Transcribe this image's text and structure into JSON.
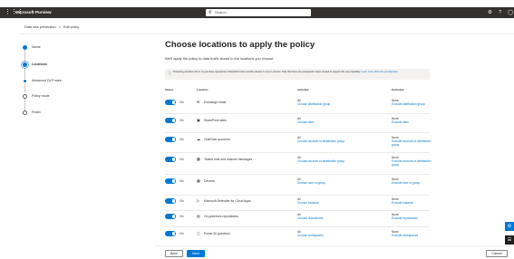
{
  "topbar": {
    "app_name": "Microsoft Purview",
    "search_placeholder": "Search",
    "waffle_glyph": "⋮⋮⋮",
    "settings_glyph": "⚙",
    "help_glyph": "?",
    "account_glyph": "◯"
  },
  "breadcrumb": {
    "items": [
      "Data loss prevention",
      ">",
      "Edit policy"
    ]
  },
  "steps": [
    {
      "label": "Name",
      "state": "done"
    },
    {
      "label": "Locations",
      "state": "current"
    },
    {
      "label": "Advanced DLP rules",
      "state": "upcoming"
    },
    {
      "label": "Policy mode",
      "state": "upcoming"
    },
    {
      "label": "Finish",
      "state": "upcoming"
    }
  ],
  "main": {
    "title": "Choose locations to apply the policy",
    "subtitle": "We'll apply the policy to data that's stored in the locations you choose.",
    "info": {
      "text": "Protecting sensitive info in on-premises repositories (SharePoint sites and file shares) is now in preview. Note that there are prerequisite steps needed to support this new capability.",
      "link": "Learn more about the prerequisites"
    },
    "columns": {
      "status": "Status",
      "location": "Location",
      "included": "Included",
      "excluded": "Excluded"
    },
    "rows": [
      {
        "status": "On",
        "icon": "✉",
        "location": "Exchange email",
        "included": "All",
        "included_link": "Choose distribution group",
        "excluded": "None",
        "excluded_link": "Exclude distribution group"
      },
      {
        "status": "On",
        "icon": "▣",
        "location": "SharePoint sites",
        "included": "All",
        "included_link": "Choose sites",
        "excluded": "None",
        "excluded_link": "Exclude sites"
      },
      {
        "status": "On",
        "icon": "☁",
        "location": "OneDrive accounts",
        "included": "All",
        "included_link": "Choose account or distribution group",
        "excluded": "None",
        "excluded_link": "Exclude account or distribution group"
      },
      {
        "status": "On",
        "icon": "▩",
        "location": "Teams chat and channel messages",
        "included": "All",
        "included_link": "Choose account or distribution group",
        "excluded": "None",
        "excluded_link": "Exclude account or distribution group"
      },
      {
        "status": "On",
        "icon": "▦",
        "location": "Devices",
        "included": "All",
        "included_link": "Choose user or group",
        "excluded": "None",
        "excluded_link": "Exclude user or group"
      },
      {
        "status": "On",
        "icon": "▷",
        "location": "Microsoft Defender for Cloud Apps",
        "included": "All",
        "included_link": "Choose instance",
        "excluded": "None",
        "excluded_link": "Exclude instance"
      },
      {
        "status": "On",
        "icon": "▤",
        "location": "On-premises repositories",
        "included": "All",
        "included_link": "Choose repositories",
        "excluded": "None",
        "excluded_link": "Exclude repositories"
      },
      {
        "status": "On",
        "icon": "▢",
        "location": "Power BI (preview)",
        "included": "All",
        "included_link": "Choose workspaces",
        "excluded": "None",
        "excluded_link": "Exclude workspaces"
      }
    ]
  },
  "footer": {
    "back_label": "Back",
    "next_label": "Next",
    "cancel_label": "Cancel"
  },
  "side_buttons": {
    "top_glyph": "⚙",
    "bottom_glyph": "☰"
  },
  "colors": {
    "accent": "#0078d4",
    "topbar": "#323130"
  }
}
